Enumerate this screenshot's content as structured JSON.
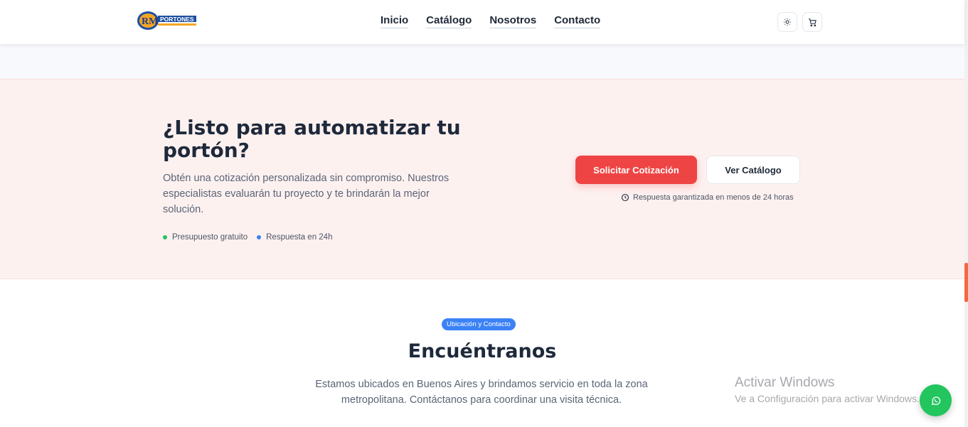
{
  "header": {
    "logo_text": "PORTONES",
    "logo_subtext": "AUTOMATIZACIÓN Y REPARACIÓN",
    "logo_monogram": "RM",
    "nav": [
      "Inicio",
      "Catálogo",
      "Nosotros",
      "Contacto"
    ],
    "theme_icon": "sun-icon",
    "cart_icon": "cart-icon"
  },
  "cta": {
    "title": "¿Listo para automatizar tu portón?",
    "description": "Obtén una cotización personalizada sin compromiso. Nuestros especialistas evaluarán tu proyecto y te brindarán la mejor solución.",
    "bullets": [
      {
        "label": "Presupuesto gratuito",
        "color": "#22c55e"
      },
      {
        "label": "Respuesta en 24h",
        "color": "#3b82f6"
      }
    ],
    "primary_button": "Solicitar Cotización",
    "secondary_button": "Ver Catálogo",
    "guarantee": "Respuesta garantizada en menos de 24 horas"
  },
  "location": {
    "badge": "Ubicación y Contacto",
    "title": "Encuéntranos",
    "description": "Estamos ubicados en Buenos Aires y brindamos servicio en toda la zona metropolitana. Contáctanos para coordinar una visita técnica."
  },
  "watermark": {
    "title": "Activar Windows",
    "subtitle": "Ve a Configuración para activar Windows."
  },
  "colors": {
    "accent": "#ef4444",
    "cta_background": "#fdf1f0",
    "badge": "#3b82f6",
    "whatsapp": "#22c55e"
  }
}
